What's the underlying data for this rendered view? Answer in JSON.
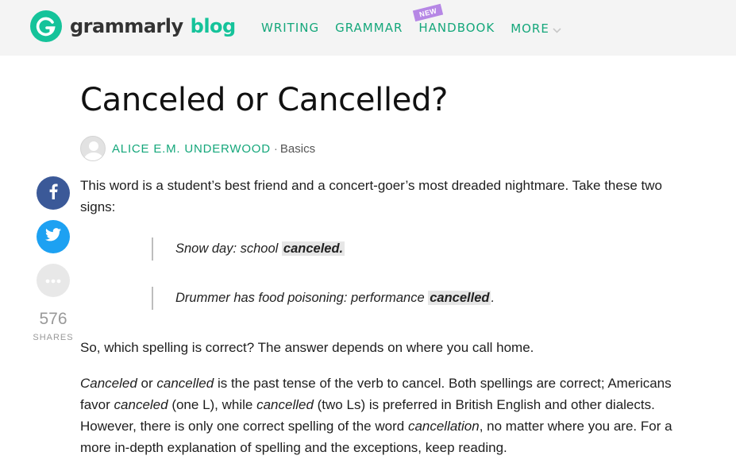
{
  "header": {
    "logo_word": "grammarly",
    "logo_blog": "blog",
    "nav": [
      {
        "label": "WRITING"
      },
      {
        "label": "GRAMMAR"
      },
      {
        "label": "HANDBOOK",
        "badge": "NEW"
      },
      {
        "label": "MORE"
      }
    ]
  },
  "article": {
    "title": "Canceled or Cancelled?",
    "author": "ALICE E.M. UNDERWOOD",
    "separator": "·",
    "category": "Basics",
    "intro": "This word is a student’s best friend and a concert-goer’s most dreaded nightmare. Take these two signs:",
    "quotes": [
      {
        "text": "Snow day: school ",
        "highlight": "canceled.",
        "after": ""
      },
      {
        "text": "Drummer has food poisoning: performance ",
        "highlight": "cancelled",
        "after": "."
      }
    ],
    "question": "So, which spelling is correct? The answer depends on where you call home.",
    "explanation": {
      "w1": "Canceled",
      "t1": " or ",
      "w2": "cancelled",
      "t2": " is the past tense of the verb to cancel. Both spellings are correct; Americans favor ",
      "w3": "canceled",
      "t3": " (one L), while ",
      "w4": "cancelled",
      "t4": " (two Ls) is preferred in British English and other dialects. However, there is only one correct spelling of the word ",
      "w5": "cancellation",
      "t5": ", no matter where you are. For a more in-depth explanation of spelling and the exceptions, keep reading."
    }
  },
  "share": {
    "count": "576",
    "label": "SHARES",
    "buttons": [
      {
        "icon": "facebook-icon",
        "color": "#3b5998"
      },
      {
        "icon": "twitter-icon",
        "color": "#1da1f2"
      },
      {
        "icon": "more-dots-icon",
        "color": "#e8e8e8"
      }
    ]
  },
  "colors": {
    "brand_green": "#15c39a",
    "nav_green": "#15a77b",
    "badge_purple": "#b687e5",
    "header_bg": "#f4f4f4"
  }
}
